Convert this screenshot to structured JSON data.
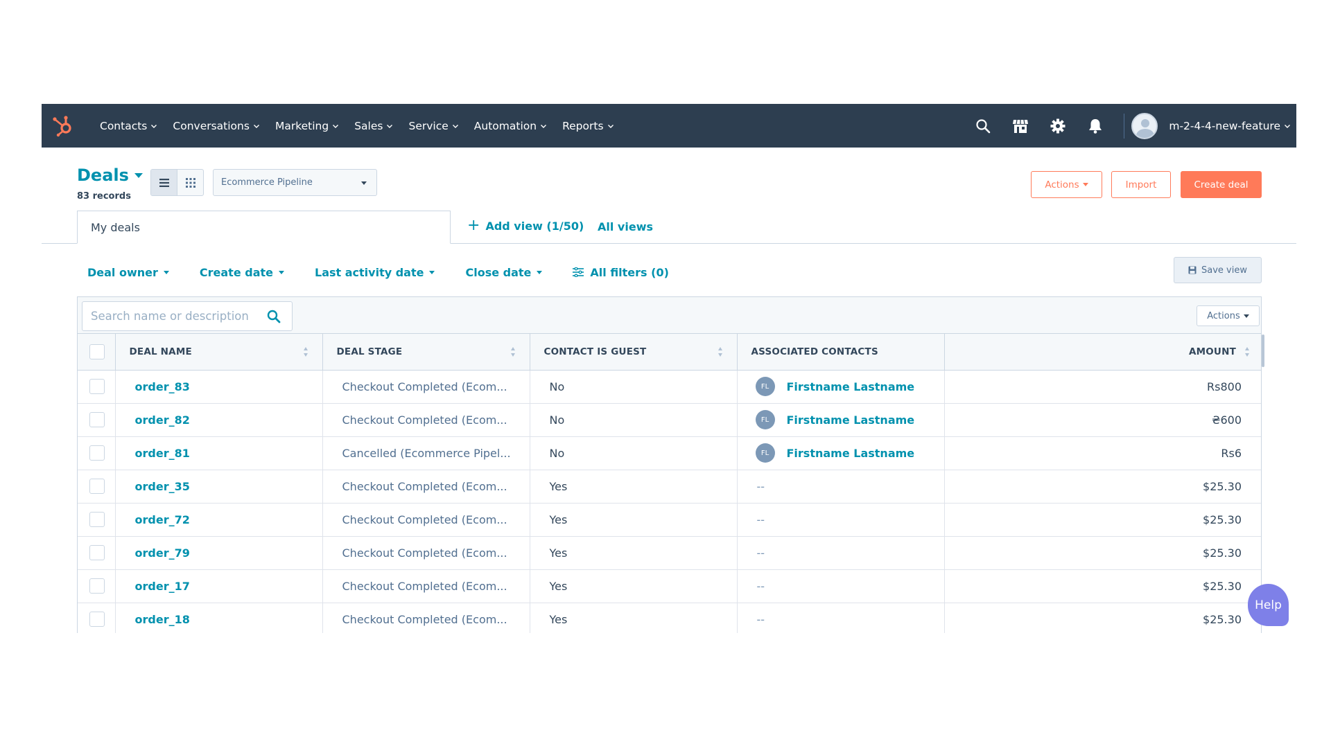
{
  "nav": {
    "items": [
      "Contacts",
      "Conversations",
      "Marketing",
      "Sales",
      "Service",
      "Automation",
      "Reports"
    ],
    "account": "m-2-4-4-new-feature",
    "icons": [
      "search-icon",
      "marketplace-icon",
      "settings-icon",
      "notifications-icon"
    ]
  },
  "header": {
    "title": "Deals",
    "records": "83 records",
    "pipeline": "Ecommerce Pipeline",
    "actions_label": "Actions",
    "import_label": "Import",
    "create_label": "Create deal"
  },
  "tabs": {
    "active": "My deals",
    "add_view": "Add view (1/50)",
    "all_views": "All views"
  },
  "filters": {
    "items": [
      "Deal owner",
      "Create date",
      "Last activity date",
      "Close date"
    ],
    "all_filters": "All filters (0)",
    "save_view": "Save view"
  },
  "table": {
    "search_placeholder": "Search name or description",
    "actions_label": "Actions",
    "columns": [
      "DEAL NAME",
      "DEAL STAGE",
      "CONTACT IS GUEST",
      "ASSOCIATED CONTACTS",
      "AMOUNT"
    ],
    "rows": [
      {
        "name": "order_83",
        "stage": "Checkout Completed (Ecom...",
        "guest": "No",
        "contact_initials": "FL",
        "contact": "Firstname Lastname",
        "amount": "Rs800"
      },
      {
        "name": "order_82",
        "stage": "Checkout Completed (Ecom...",
        "guest": "No",
        "contact_initials": "FL",
        "contact": "Firstname Lastname",
        "amount": "₴600"
      },
      {
        "name": "order_81",
        "stage": "Cancelled (Ecommerce Pipel...",
        "guest": "No",
        "contact_initials": "FL",
        "contact": "Firstname Lastname",
        "amount": "Rs6"
      },
      {
        "name": "order_35",
        "stage": "Checkout Completed (Ecom...",
        "guest": "Yes",
        "contact_initials": "",
        "contact": "--",
        "amount": "$25.30"
      },
      {
        "name": "order_72",
        "stage": "Checkout Completed (Ecom...",
        "guest": "Yes",
        "contact_initials": "",
        "contact": "--",
        "amount": "$25.30"
      },
      {
        "name": "order_79",
        "stage": "Checkout Completed (Ecom...",
        "guest": "Yes",
        "contact_initials": "",
        "contact": "--",
        "amount": "$25.30"
      },
      {
        "name": "order_17",
        "stage": "Checkout Completed (Ecom...",
        "guest": "Yes",
        "contact_initials": "",
        "contact": "--",
        "amount": "$25.30"
      },
      {
        "name": "order_18",
        "stage": "Checkout Completed (Ecom...",
        "guest": "Yes",
        "contact_initials": "",
        "contact": "--",
        "amount": "$25.30"
      }
    ]
  },
  "help_label": "Help",
  "colors": {
    "nav_bg": "#2d3e50",
    "link": "#0091ae",
    "accent": "#ff7a59",
    "help": "#7e80e8"
  }
}
